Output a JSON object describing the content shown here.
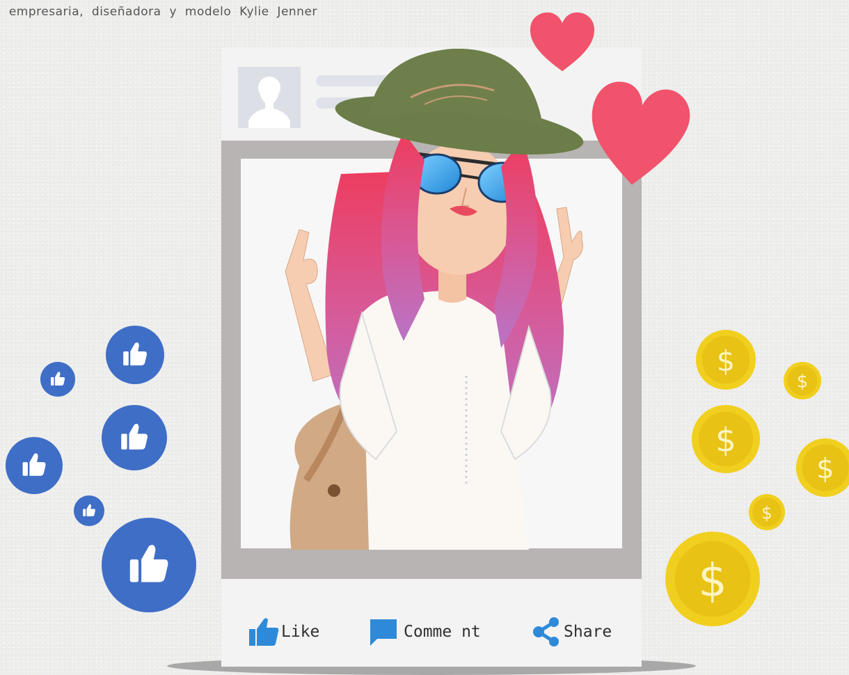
{
  "caption": "a empresaria, diseñadora y modelo Kylie Jenner",
  "actions": {
    "like_label": "Like",
    "comment_label": "Comme nt",
    "share_label": "Share"
  },
  "coin_symbol": "$",
  "icons": [
    "profile-avatar-icon",
    "thumbs-up-icon",
    "comment-icon",
    "share-icon",
    "heart-icon",
    "dollar-coin-icon"
  ],
  "colors": {
    "like_blue": "#3f6ec6",
    "heart_pink": "#f0536b",
    "coin_gold": "#f1cf1e",
    "frame_gray": "#b7b4b3",
    "hat_green": "#6e7f4b",
    "hair_pink": "#e8456a"
  }
}
